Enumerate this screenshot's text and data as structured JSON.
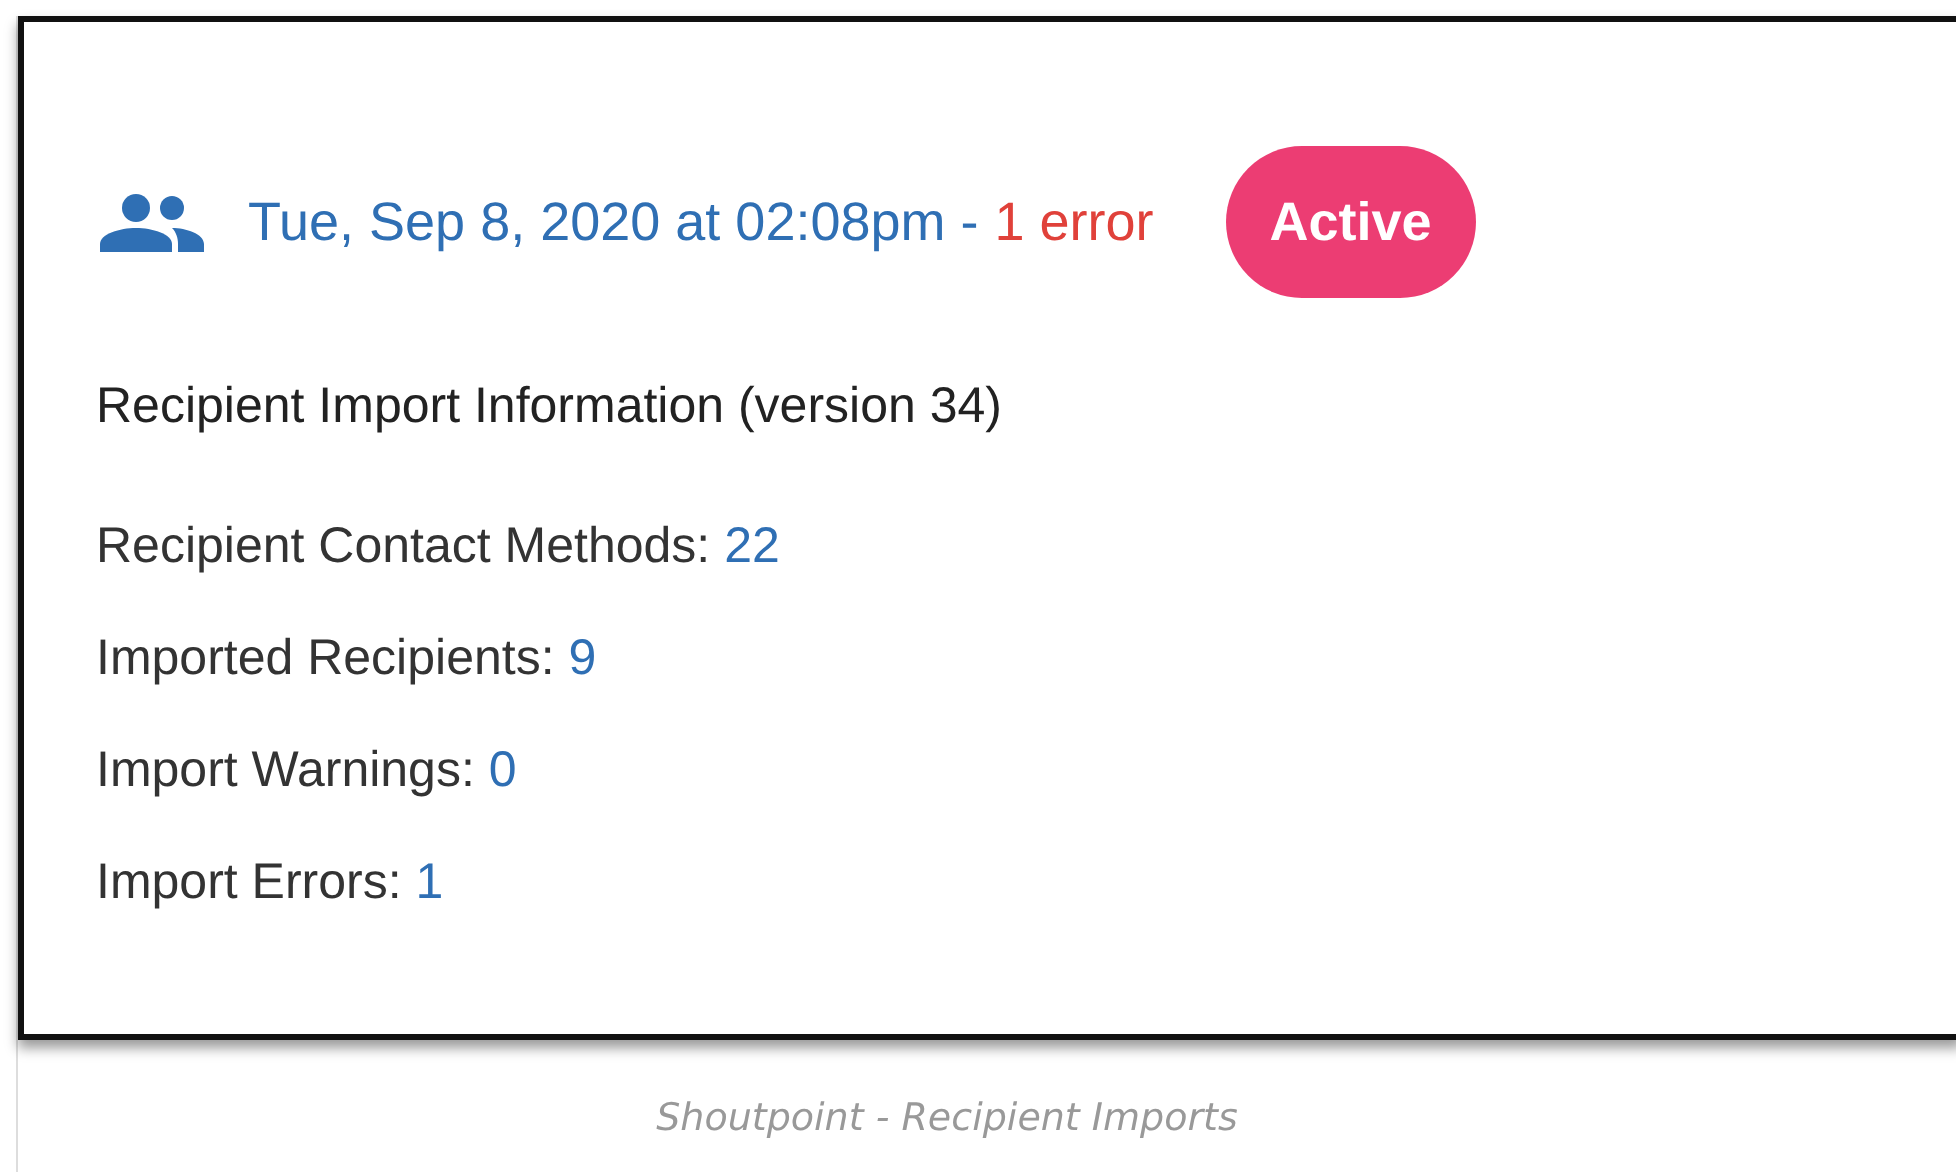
{
  "import_card": {
    "timestamp": "Tue, Sep 8, 2020 at 02:08pm -",
    "error_summary": "1 error",
    "status_badge": "Active",
    "heading": "Recipient Import Information (version 34)",
    "stats": [
      {
        "label": "Recipient Contact Methods:",
        "value": "22"
      },
      {
        "label": "Imported Recipients:",
        "value": "9"
      },
      {
        "label": "Import Warnings:",
        "value": "0"
      },
      {
        "label": "Import Errors:",
        "value": "1"
      }
    ]
  },
  "caption": "Shoutpoint - Recipient Imports"
}
